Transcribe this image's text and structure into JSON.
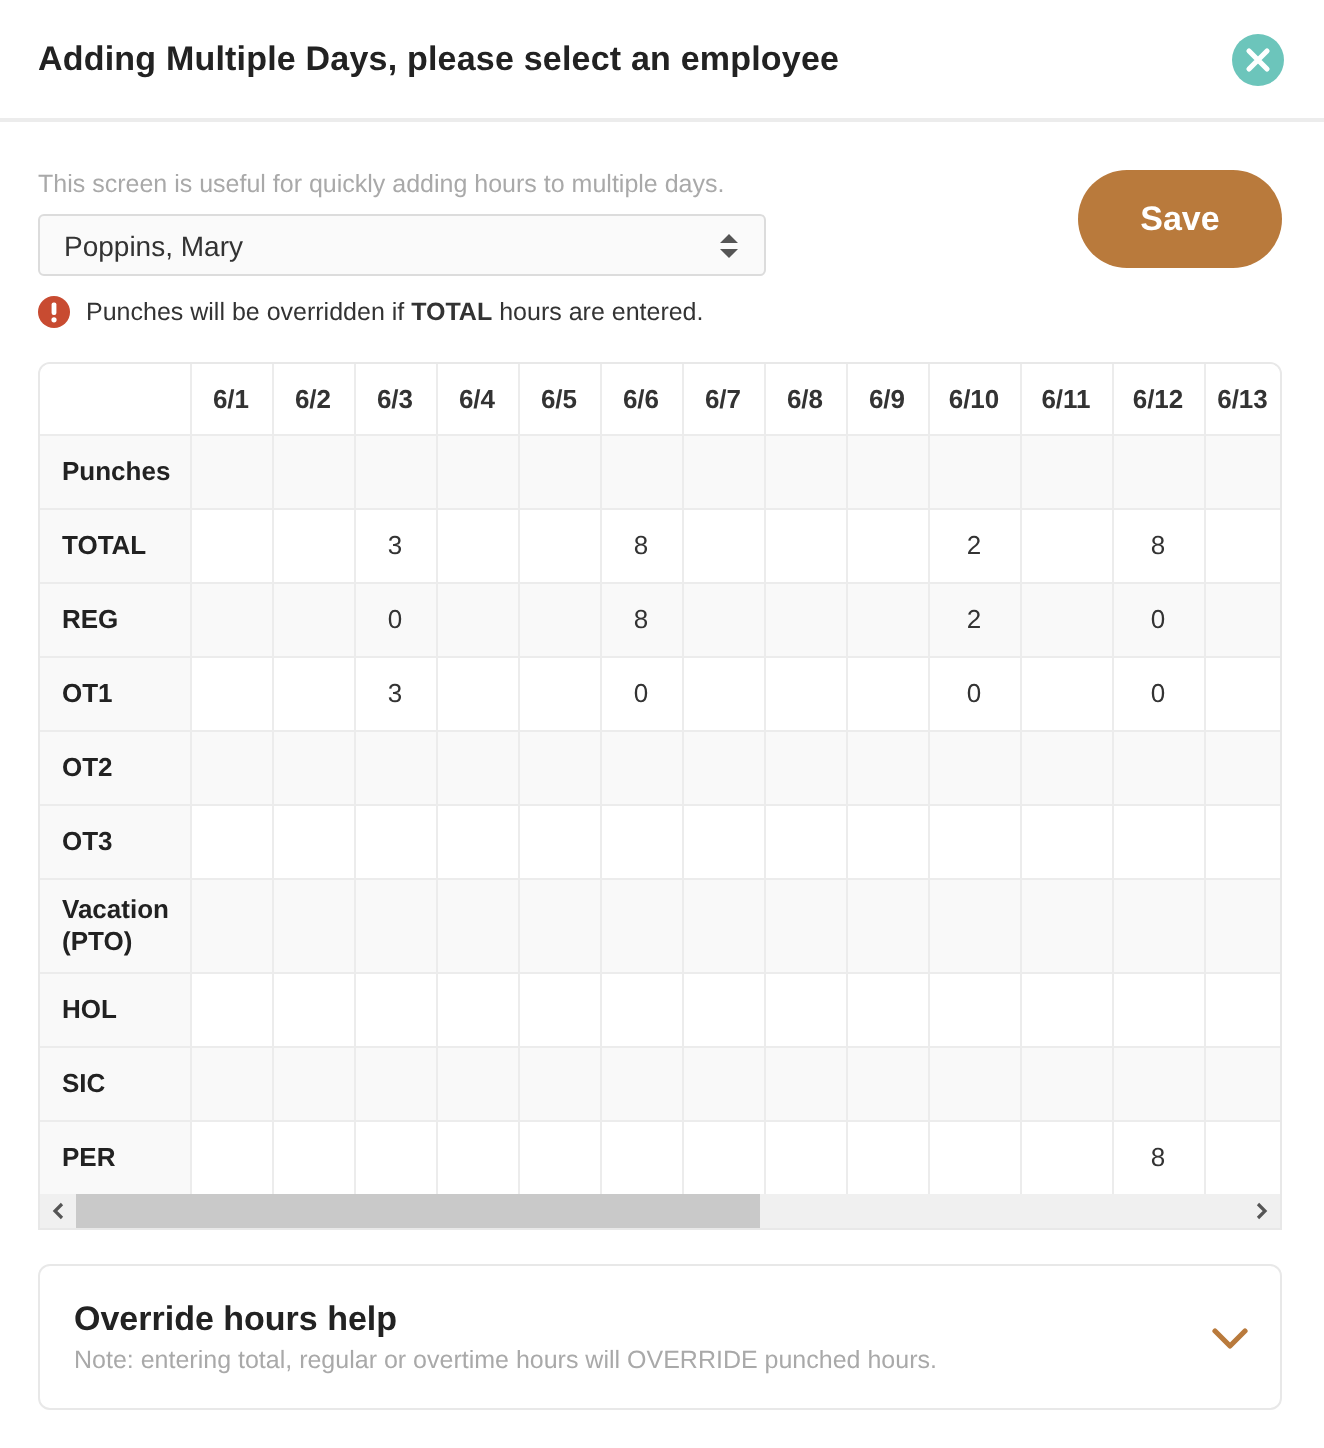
{
  "dialog": {
    "title": "Adding Multiple Days, please select an employee"
  },
  "intro": "This screen is useful for quickly adding hours to multiple days.",
  "employee_select": {
    "value": "Poppins, Mary"
  },
  "save_button": "Save",
  "warning": "Punches will be overridden if **TOTAL** hours are entered.",
  "table": {
    "columns": [
      "6/1",
      "6/2",
      "6/3",
      "6/4",
      "6/5",
      "6/6",
      "6/7",
      "6/8",
      "6/9",
      "6/10",
      "6/11",
      "6/12",
      "6/13"
    ],
    "rows": [
      {
        "label": "Punches",
        "cells": [
          null,
          null,
          null,
          null,
          null,
          null,
          null,
          null,
          null,
          null,
          null,
          null,
          null
        ]
      },
      {
        "label": "TOTAL",
        "cells": [
          null,
          null,
          "3",
          null,
          null,
          "8",
          null,
          null,
          null,
          "2",
          null,
          "8",
          null
        ]
      },
      {
        "label": "REG",
        "cells": [
          null,
          null,
          "0",
          null,
          null,
          "8",
          null,
          null,
          null,
          "2",
          null,
          "0",
          null
        ]
      },
      {
        "label": "OT1",
        "cells": [
          null,
          null,
          "3",
          null,
          null,
          "0",
          null,
          null,
          null,
          "0",
          null,
          "0",
          null
        ]
      },
      {
        "label": "OT2",
        "cells": [
          null,
          null,
          null,
          null,
          null,
          null,
          null,
          null,
          null,
          null,
          null,
          null,
          null
        ]
      },
      {
        "label": "OT3",
        "cells": [
          null,
          null,
          null,
          null,
          null,
          null,
          null,
          null,
          null,
          null,
          null,
          null,
          null
        ]
      },
      {
        "label": "Vacation (PTO)",
        "cells": [
          null,
          null,
          null,
          null,
          null,
          null,
          null,
          null,
          null,
          null,
          null,
          null,
          null
        ]
      },
      {
        "label": "HOL",
        "cells": [
          null,
          null,
          null,
          null,
          null,
          null,
          null,
          null,
          null,
          null,
          null,
          null,
          null
        ]
      },
      {
        "label": "SIC",
        "cells": [
          null,
          null,
          null,
          null,
          null,
          null,
          null,
          null,
          null,
          null,
          null,
          null,
          null
        ]
      },
      {
        "label": "PER",
        "cells": [
          null,
          null,
          null,
          null,
          null,
          null,
          null,
          null,
          null,
          null,
          null,
          "8",
          null
        ]
      }
    ]
  },
  "help_panel": {
    "title": "Override hours help",
    "note": "Note: entering total, regular or overtime hours will OVERRIDE punched hours.",
    "expanded": false
  }
}
